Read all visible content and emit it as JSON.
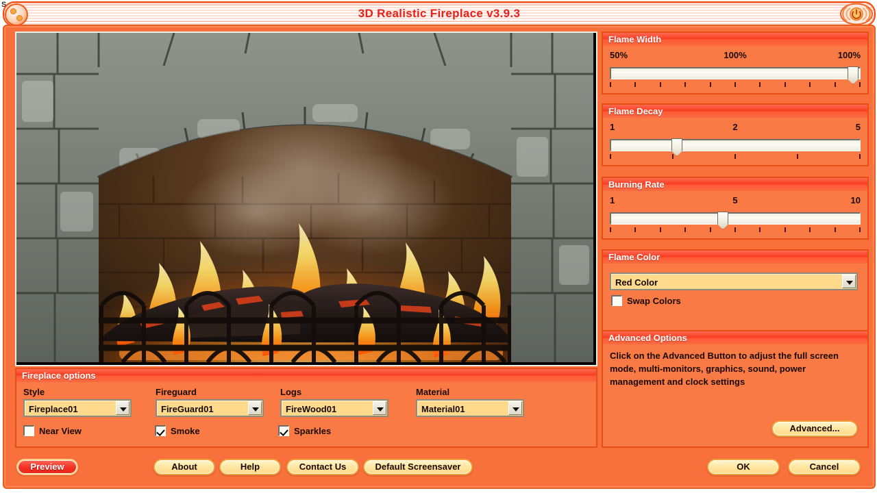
{
  "desktop": {
    "stray_letter": "S"
  },
  "window": {
    "title": "3D Realistic Fireplace v3.9.3",
    "close_icon": "power-icon",
    "left_cap_icon": "flame-emblem-icon"
  },
  "preview": {
    "name": "fireplace-preview",
    "scene": "3d fireplace with stone arch, burning logs, flames and iron fireguard"
  },
  "flame_width": {
    "title": "Flame Width",
    "left_label": "50%",
    "mid_label": "100%",
    "right_label": "100%",
    "value_percent": 100,
    "thumb_percent": 98,
    "tick_count": 11
  },
  "flame_decay": {
    "title": "Flame Decay",
    "left_label": "1",
    "mid_label": "2",
    "right_label": "5",
    "value": 2,
    "thumb_percent": 25,
    "tick_count": 5
  },
  "burning_rate": {
    "title": "Burning Rate",
    "left_label": "1",
    "mid_label": "5",
    "right_label": "10",
    "value": 5,
    "thumb_percent": 44,
    "tick_count": 11
  },
  "flame_color": {
    "title": "Flame Color",
    "selected": "Red Color",
    "dropdown_icon": "chevron-down-icon",
    "swap_colors_label": "Swap Colors",
    "swap_colors_checked": false
  },
  "advanced": {
    "title": "Advanced Options",
    "description": "Click on the Advanced Button to adjust the full screen mode, multi-monitors, graphics, sound, power management and clock settings",
    "button_label": "Advanced..."
  },
  "fireplace_options": {
    "title": "Fireplace options",
    "fields": [
      {
        "label": "Style",
        "value": "Fireplace01"
      },
      {
        "label": "Fireguard",
        "value": "FireGuard01"
      },
      {
        "label": "Logs",
        "value": "FireWood01"
      },
      {
        "label": "Material",
        "value": "Material01"
      }
    ],
    "checkboxes": [
      {
        "label": "Near View",
        "checked": false
      },
      {
        "label": "Smoke",
        "checked": true
      },
      {
        "label": "Sparkles",
        "checked": true
      }
    ]
  },
  "footer": {
    "preview_label": "Preview",
    "preview_active": true,
    "about_label": "About",
    "help_label": "Help",
    "contact_label": "Contact Us",
    "default_screensaver_label": "Default Screensaver",
    "ok_label": "OK",
    "cancel_label": "Cancel"
  },
  "colors": {
    "window_bg": "#f8703c",
    "group_header_red": "#f93c20",
    "title_text_red": "#e8201a",
    "combo_bg": "#ffd98c",
    "button_bg": "#ffe6a0",
    "active_button": "#f22f22"
  }
}
